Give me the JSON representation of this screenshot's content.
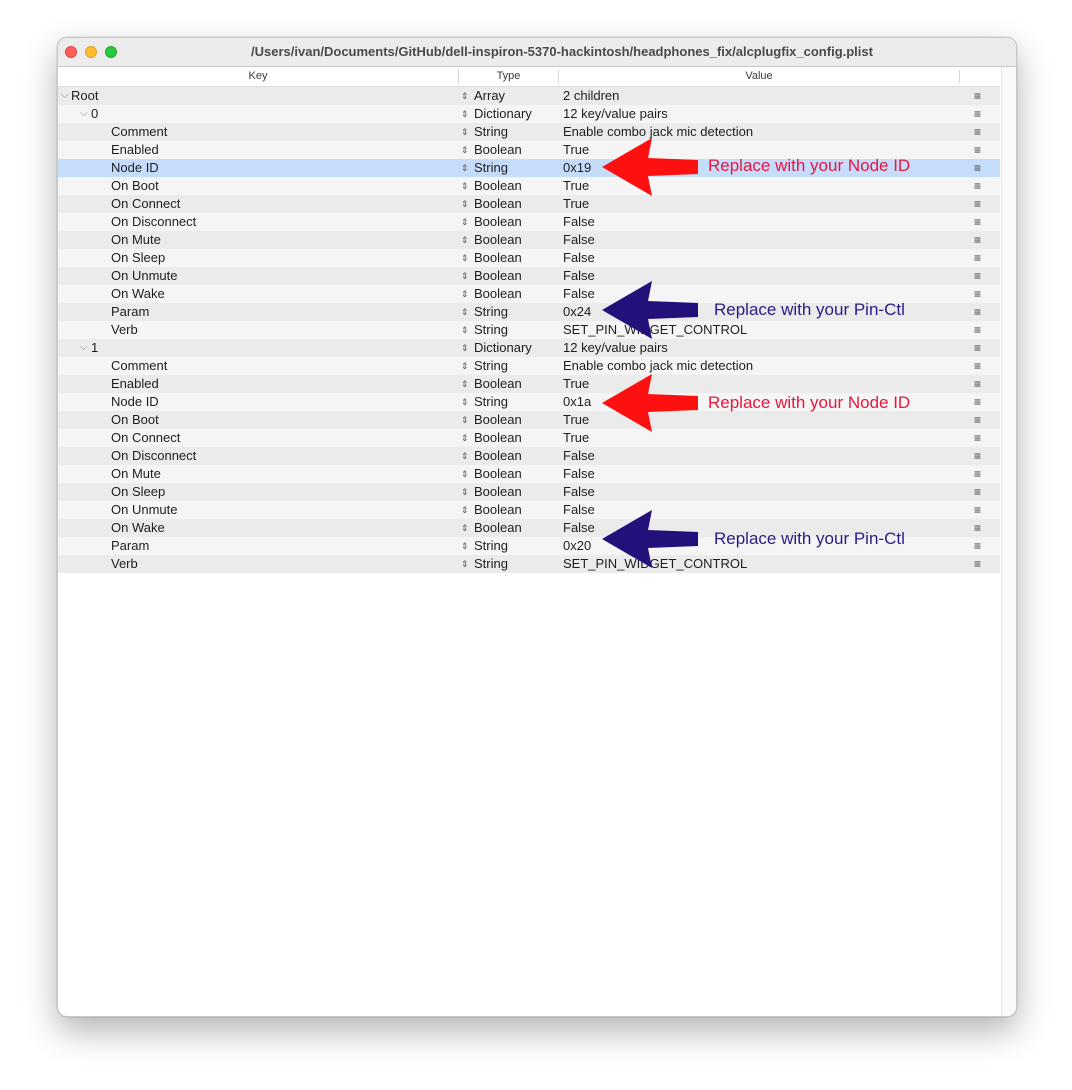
{
  "window": {
    "title": "/Users/ivan/Documents/GitHub/dell-inspiron-5370-hackintosh/headphones_fix/alcplugfix_config.plist"
  },
  "columns": {
    "key": "Key",
    "type": "Type",
    "value": "Value"
  },
  "colors": {
    "selected_row": "#c6dcfb",
    "annotation_red": "#e8173f",
    "annotation_blue": "#2b1a86",
    "arrow_red": "#ff1010",
    "arrow_blue": "#24107a"
  },
  "icons": {
    "row_menu": "≡",
    "stepper": "⇕",
    "chevron": "⌵"
  },
  "rows": [
    {
      "key": "Root",
      "type": "Array",
      "value": "2 children",
      "level": 0,
      "expandable": true
    },
    {
      "key": "0",
      "type": "Dictionary",
      "value": "12 key/value pairs",
      "level": 1,
      "expandable": true
    },
    {
      "key": "Comment",
      "type": "String",
      "value": "Enable combo jack mic detection",
      "level": 2
    },
    {
      "key": "Enabled",
      "type": "Boolean",
      "value": "True",
      "level": 2
    },
    {
      "key": "Node ID",
      "type": "String",
      "value": "0x19",
      "level": 2,
      "selected": true
    },
    {
      "key": "On Boot",
      "type": "Boolean",
      "value": "True",
      "level": 2
    },
    {
      "key": "On Connect",
      "type": "Boolean",
      "value": "True",
      "level": 2
    },
    {
      "key": "On Disconnect",
      "type": "Boolean",
      "value": "False",
      "level": 2
    },
    {
      "key": "On Mute",
      "type": "Boolean",
      "value": "False",
      "level": 2
    },
    {
      "key": "On Sleep",
      "type": "Boolean",
      "value": "False",
      "level": 2
    },
    {
      "key": "On Unmute",
      "type": "Boolean",
      "value": "False",
      "level": 2
    },
    {
      "key": "On Wake",
      "type": "Boolean",
      "value": "False",
      "level": 2
    },
    {
      "key": "Param",
      "type": "String",
      "value": "0x24",
      "level": 2
    },
    {
      "key": "Verb",
      "type": "String",
      "value": "SET_PIN_WIDGET_CONTROL",
      "level": 2
    },
    {
      "key": "1",
      "type": "Dictionary",
      "value": "12 key/value pairs",
      "level": 1,
      "expandable": true
    },
    {
      "key": "Comment",
      "type": "String",
      "value": "Enable combo jack mic detection",
      "level": 2
    },
    {
      "key": "Enabled",
      "type": "Boolean",
      "value": "True",
      "level": 2
    },
    {
      "key": "Node ID",
      "type": "String",
      "value": "0x1a",
      "level": 2
    },
    {
      "key": "On Boot",
      "type": "Boolean",
      "value": "True",
      "level": 2
    },
    {
      "key": "On Connect",
      "type": "Boolean",
      "value": "True",
      "level": 2
    },
    {
      "key": "On Disconnect",
      "type": "Boolean",
      "value": "False",
      "level": 2
    },
    {
      "key": "On Mute",
      "type": "Boolean",
      "value": "False",
      "level": 2
    },
    {
      "key": "On Sleep",
      "type": "Boolean",
      "value": "False",
      "level": 2
    },
    {
      "key": "On Unmute",
      "type": "Boolean",
      "value": "False",
      "level": 2
    },
    {
      "key": "On Wake",
      "type": "Boolean",
      "value": "False",
      "level": 2
    },
    {
      "key": "Param",
      "type": "String",
      "value": "0x20",
      "level": 2
    },
    {
      "key": "Verb",
      "type": "String",
      "value": "SET_PIN_WIDGET_CONTROL",
      "level": 2
    }
  ],
  "annotations": {
    "node_id_1": "Replace with your Node ID",
    "pin_ctl_1": "Replace with your Pin-Ctl",
    "node_id_2": "Replace with your Node ID",
    "pin_ctl_2": "Replace with your Pin-Ctl"
  }
}
